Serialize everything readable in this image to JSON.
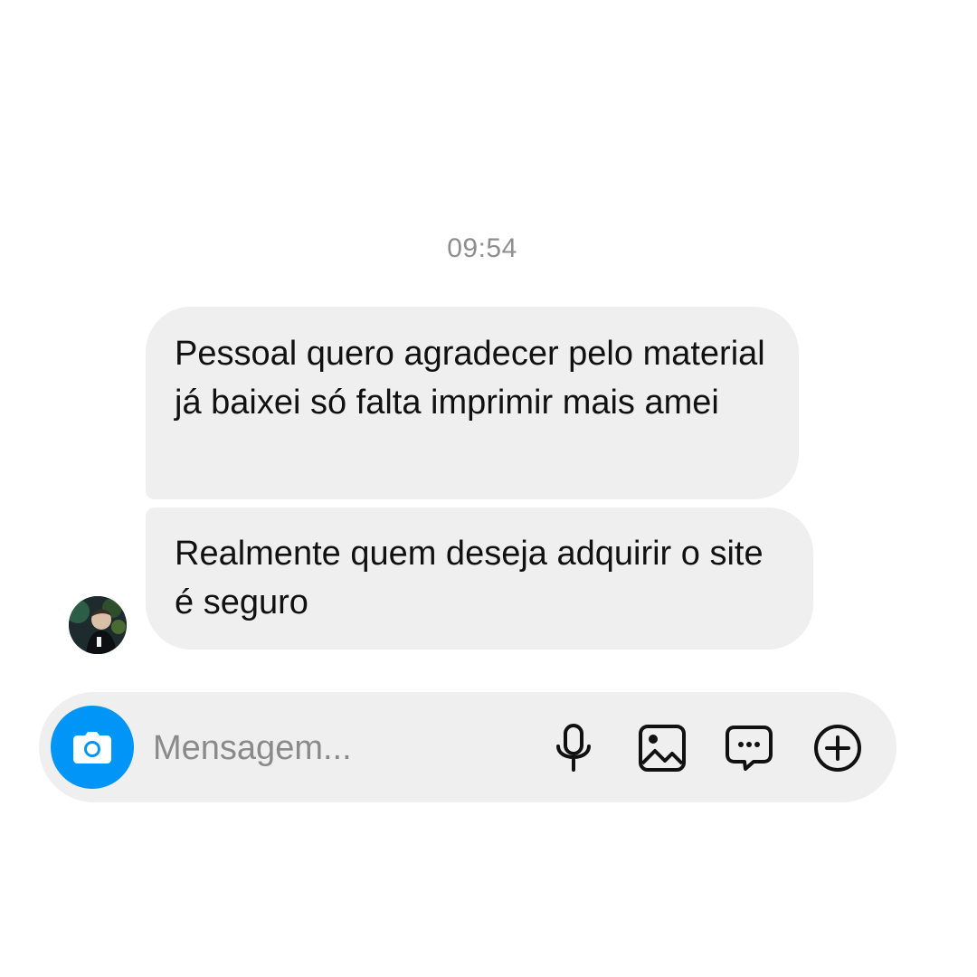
{
  "chat": {
    "timestamp": "09:54",
    "messages": [
      {
        "text": "Pessoal quero agradecer pelo material já baixei só falta imprimir mais amei"
      },
      {
        "text": "Realmente quem deseja adquirir o site é seguro"
      }
    ],
    "sender_avatar": "user-avatar"
  },
  "composer": {
    "placeholder": "Mensagem...",
    "value": "",
    "icons": {
      "camera": "camera-icon",
      "microphone": "microphone-icon",
      "gallery": "image-gallery-icon",
      "sticker": "sticker-message-icon",
      "add": "plus-circle-icon"
    }
  },
  "colors": {
    "background": "#ffffff",
    "bubble": "#efefef",
    "text": "#111111",
    "timestamp": "#8e8e8e",
    "accent": "#0095f6",
    "icon": "#111111"
  }
}
